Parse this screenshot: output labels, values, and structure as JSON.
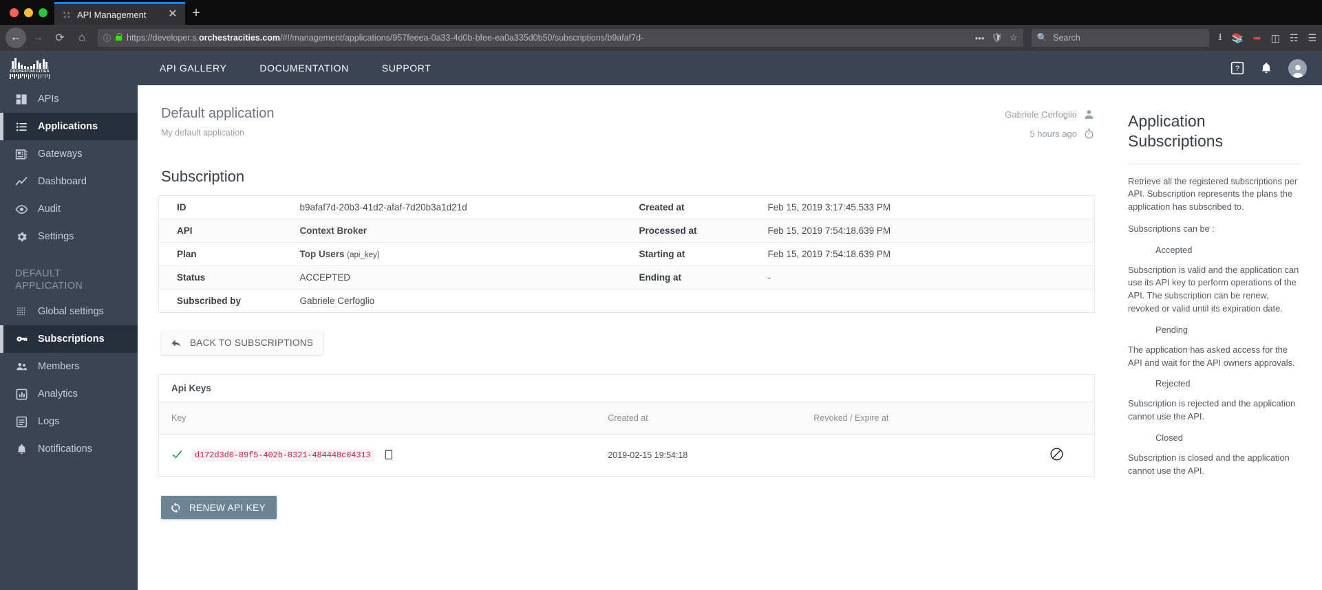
{
  "browser": {
    "tab_title": "API Management",
    "tab_close": "✕",
    "new_tab": "+",
    "url_display_pre": "https://developer.s.",
    "url_display_domain": "orchestracities.com",
    "url_display_post": "/#!/management/applications/957feeea-0a33-4d0b-bfee-ea0a335d0b50/subscriptions/b9afaf7d-",
    "url_full": "https://developer.s.orchestracities.com/#!/management/applications/957feeea-0a33-4d0b-bfee-ea0a335d0b50/subscriptions/b9afaf7d-20b3-41d2-afaf-7d20b3a1d21d",
    "search_placeholder": "Search",
    "back": "←",
    "forward": "→",
    "reload": "⟳",
    "home": "⌂",
    "menu_dots": "•••"
  },
  "topnav": {
    "brand_text": "ORCHESTRA CITIES",
    "items": [
      {
        "label": "API GALLERY"
      },
      {
        "label": "DOCUMENTATION"
      },
      {
        "label": "SUPPORT"
      }
    ]
  },
  "sidebar": {
    "items": [
      {
        "label": "APIs",
        "icon": "apis-icon",
        "active": false
      },
      {
        "label": "Applications",
        "icon": "applications-icon",
        "active": true
      },
      {
        "label": "Gateways",
        "icon": "gateways-icon",
        "active": false
      },
      {
        "label": "Dashboard",
        "icon": "dashboard-icon",
        "active": false
      },
      {
        "label": "Audit",
        "icon": "audit-icon",
        "active": false
      },
      {
        "label": "Settings",
        "icon": "settings-icon",
        "active": false
      }
    ],
    "group_label": "DEFAULT APPLICATION",
    "group_items": [
      {
        "label": "Global settings",
        "icon": "global-settings-icon",
        "active": false
      },
      {
        "label": "Subscriptions",
        "icon": "key-icon",
        "active": true
      },
      {
        "label": "Members",
        "icon": "members-icon",
        "active": false
      },
      {
        "label": "Analytics",
        "icon": "analytics-icon",
        "active": false
      },
      {
        "label": "Logs",
        "icon": "logs-icon",
        "active": false
      },
      {
        "label": "Notifications",
        "icon": "bell-icon",
        "active": false
      }
    ]
  },
  "app_header": {
    "title": "Default application",
    "subtitle": "My default application",
    "owner": "Gabriele Cerfoglio",
    "updated": "5 hours ago"
  },
  "subscription": {
    "section_title": "Subscription",
    "rows": [
      {
        "key": "ID",
        "value": "b9afaf7d-20b3-41d2-afaf-7d20b3a1d21d",
        "bold": false,
        "key2": "Created at",
        "value2": "Feb 15, 2019 3:17:45.533 PM"
      },
      {
        "key": "API",
        "value": "Context Broker",
        "bold": true,
        "key2": "Processed at",
        "value2": "Feb 15, 2019 7:54:18.639 PM"
      },
      {
        "key": "Plan",
        "value": "Top Users",
        "value_sup": "(api_key)",
        "bold": true,
        "key2": "Starting at",
        "value2": "Feb 15, 2019 7:54:18.639 PM"
      },
      {
        "key": "Status",
        "value": "ACCEPTED",
        "bold": false,
        "key2": "Ending at",
        "value2": "-"
      },
      {
        "key": "Subscribed by",
        "value": "Gabriele Cerfoglio",
        "bold": false,
        "key2": "",
        "value2": ""
      }
    ]
  },
  "buttons": {
    "back_to_subscriptions": "BACK TO SUBSCRIPTIONS",
    "renew_api_key": "RENEW API KEY"
  },
  "api_keys": {
    "panel_title": "Api Keys",
    "columns": [
      "Key",
      "Created at",
      "Revoked / Expire at"
    ],
    "rows": [
      {
        "key": "d172d3d0-89f5-402b-8321-484448c04313",
        "created_at": "2019-02-15 19:54:18",
        "revoked_expire_at": ""
      }
    ]
  },
  "help": {
    "title": "Application Subscriptions",
    "blocks": [
      {
        "type": "p",
        "text": "Retrieve all the registered subscriptions per API. Subscription represents the plans the application has subscribed to."
      },
      {
        "type": "p",
        "text": "Subscriptions can be :"
      },
      {
        "type": "term",
        "text": "Accepted"
      },
      {
        "type": "p",
        "text": "Subscription is valid and the application can use its API key to perform operations of the API. The subscription can be renew, revoked or valid until its expiration date."
      },
      {
        "type": "term",
        "text": "Pending"
      },
      {
        "type": "p",
        "text": "The application has asked access for the API and wait for the API owners approvals."
      },
      {
        "type": "term",
        "text": "Rejected"
      },
      {
        "type": "p",
        "text": "Subscription is rejected and the application cannot use the API."
      },
      {
        "type": "term",
        "text": "Closed"
      },
      {
        "type": "p",
        "text": "Subscription is closed and the application cannot use the API."
      }
    ]
  },
  "colors": {
    "sidebar_bg": "#3b4455",
    "sidebar_active_bg": "#262d3b",
    "key_text": "#c7254e",
    "renew_button_bg": "#6b8496",
    "check_green": "#2e9e4f",
    "tab_accent": "#0a84ff"
  }
}
